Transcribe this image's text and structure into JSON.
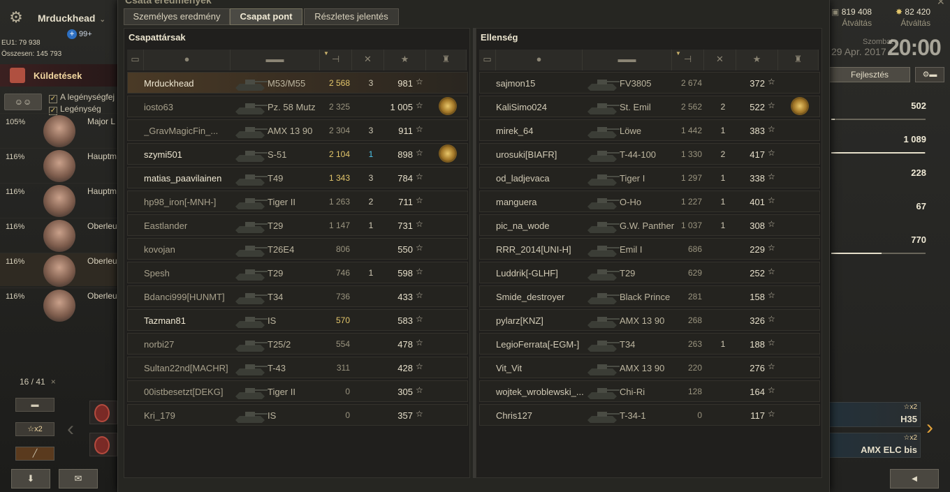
{
  "player": {
    "name": "Mrduckhead",
    "plus_badge": "99+",
    "eu_rating": "EU1: 79 938",
    "total": "Összesen: 145 793"
  },
  "left": {
    "missions_label": "Küldetések",
    "checks": [
      "A legénységfej",
      "Legénység auto"
    ],
    "crew": [
      {
        "pct": "105%",
        "rank": "Major L"
      },
      {
        "pct": "116%",
        "rank": "Hauptm"
      },
      {
        "pct": "116%",
        "rank": "Hauptm"
      },
      {
        "pct": "116%",
        "rank": "Oberleu"
      },
      {
        "pct": "116%",
        "rank": "Oberleu"
      },
      {
        "pct": "116%",
        "rank": "Oberleu"
      }
    ],
    "counter": "16 / 41",
    "counter_close": "×",
    "x2_label": "x2"
  },
  "right": {
    "credits": "819 408",
    "credits_label": "Átváltás",
    "gold": "82 420",
    "gold_label": "Átváltás",
    "weekday": "Szombat",
    "date": "29 Apr. 2017",
    "time": "20:00",
    "upgrade_label": "Fejlesztés",
    "stats": [
      "502",
      "1 089",
      "228",
      "67",
      "770"
    ],
    "stat_fills": [
      0.04,
      0.99,
      0,
      0,
      0.53
    ],
    "tanks": [
      {
        "name": "H35",
        "badge": "x2"
      },
      {
        "name": "AMX ELC bis",
        "badge": "x2"
      }
    ]
  },
  "dialog": {
    "title": "Csata eredmények",
    "tabs": [
      "Személyes eredmény",
      "Csapat pont",
      "Részletes jelentés"
    ],
    "active_tab": 1
  },
  "allies": {
    "title": "Csapattársak",
    "rows": [
      {
        "name": "Mrduckhead",
        "tank": "M53/M55",
        "dmg": "2 568",
        "kills": "3",
        "xp": "981",
        "medal": false,
        "self": true,
        "gold": true,
        "nameStyle": "bright"
      },
      {
        "name": "iosto63",
        "tank": "Pz. 58 Mutz",
        "dmg": "2 325",
        "kills": "",
        "xp": "1 005",
        "medal": true,
        "self": false,
        "gold": false,
        "nameStyle": "dim"
      },
      {
        "name": "_GravMagicFin_...",
        "tank": "AMX 13 90",
        "dmg": "2 304",
        "kills": "3",
        "xp": "911",
        "medal": false,
        "self": false,
        "gold": false,
        "nameStyle": "dim"
      },
      {
        "name": "szymi501",
        "tank": "S-51",
        "dmg": "2 104",
        "kills": "1",
        "xp": "898",
        "medal": true,
        "self": false,
        "gold": true,
        "nameStyle": "bright",
        "killsBlue": true
      },
      {
        "name": "matias_paavilainen",
        "tank": "T49",
        "dmg": "1 343",
        "kills": "3",
        "xp": "784",
        "medal": false,
        "self": false,
        "gold": true,
        "nameStyle": "bright"
      },
      {
        "name": "hp98_iron[-MNH-]",
        "tank": "Tiger II",
        "dmg": "1 263",
        "kills": "2",
        "xp": "711",
        "medal": false,
        "self": false,
        "gold": false,
        "nameStyle": "dim"
      },
      {
        "name": "Eastlander",
        "tank": "T29",
        "dmg": "1 147",
        "kills": "1",
        "xp": "731",
        "medal": false,
        "self": false,
        "gold": false,
        "nameStyle": "dim"
      },
      {
        "name": "kovojan",
        "tank": "T26E4",
        "dmg": "806",
        "kills": "",
        "xp": "550",
        "medal": false,
        "self": false,
        "gold": false,
        "nameStyle": "dim"
      },
      {
        "name": "Spesh",
        "tank": "T29",
        "dmg": "746",
        "kills": "1",
        "xp": "598",
        "medal": false,
        "self": false,
        "gold": false,
        "nameStyle": "dim"
      },
      {
        "name": "Bdanci999[HUNMT]",
        "tank": "T34",
        "dmg": "736",
        "kills": "",
        "xp": "433",
        "medal": false,
        "self": false,
        "gold": false,
        "nameStyle": "dim"
      },
      {
        "name": "Tazman81",
        "tank": "IS",
        "dmg": "570",
        "kills": "",
        "xp": "583",
        "medal": false,
        "self": false,
        "gold": true,
        "nameStyle": "bright"
      },
      {
        "name": "norbi27",
        "tank": "T25/2",
        "dmg": "554",
        "kills": "",
        "xp": "478",
        "medal": false,
        "self": false,
        "gold": false,
        "nameStyle": "dim"
      },
      {
        "name": "Sultan22nd[MACHR]",
        "tank": "T-43",
        "dmg": "311",
        "kills": "",
        "xp": "428",
        "medal": false,
        "self": false,
        "gold": false,
        "nameStyle": "dim"
      },
      {
        "name": "00istbesetzt[DEKG]",
        "tank": "Tiger II",
        "dmg": "0",
        "kills": "",
        "xp": "305",
        "medal": false,
        "self": false,
        "gold": false,
        "nameStyle": "dim"
      },
      {
        "name": "Kri_179",
        "tank": "IS",
        "dmg": "0",
        "kills": "",
        "xp": "357",
        "medal": false,
        "self": false,
        "gold": false,
        "nameStyle": "dim"
      }
    ]
  },
  "enemies": {
    "title": "Ellenség",
    "rows": [
      {
        "name": "sajmon15",
        "tank": "FV3805",
        "dmg": "2 674",
        "kills": "",
        "xp": "372",
        "medal": false
      },
      {
        "name": "KaliSimo024",
        "tank": "St. Emil",
        "dmg": "2 562",
        "kills": "2",
        "xp": "522",
        "medal": true
      },
      {
        "name": "mirek_64",
        "tank": "Löwe",
        "dmg": "1 442",
        "kills": "1",
        "xp": "383",
        "medal": false
      },
      {
        "name": "urosuki[BIAFR]",
        "tank": "T-44-100",
        "dmg": "1 330",
        "kills": "2",
        "xp": "417",
        "medal": false
      },
      {
        "name": "od_ladjevaca",
        "tank": "Tiger I",
        "dmg": "1 297",
        "kills": "1",
        "xp": "338",
        "medal": false
      },
      {
        "name": "manguera",
        "tank": "O-Ho",
        "dmg": "1 227",
        "kills": "1",
        "xp": "401",
        "medal": false
      },
      {
        "name": "pic_na_wode",
        "tank": "G.W. Panther",
        "dmg": "1 037",
        "kills": "1",
        "xp": "308",
        "medal": false
      },
      {
        "name": "RRR_2014[UNI-H]",
        "tank": "Emil I",
        "dmg": "686",
        "kills": "",
        "xp": "229",
        "medal": false
      },
      {
        "name": "Luddrik[-GLHF]",
        "tank": "T29",
        "dmg": "629",
        "kills": "",
        "xp": "252",
        "medal": false
      },
      {
        "name": "Smide_destroyer",
        "tank": "Black Prince",
        "dmg": "281",
        "kills": "",
        "xp": "158",
        "medal": false
      },
      {
        "name": "pylarz[KNZ]",
        "tank": "AMX 13 90",
        "dmg": "268",
        "kills": "",
        "xp": "326",
        "medal": false
      },
      {
        "name": "LegioFerrata[-EGM-]",
        "tank": "T34",
        "dmg": "263",
        "kills": "1",
        "xp": "188",
        "medal": false
      },
      {
        "name": "Vit_Vit",
        "tank": "AMX 13 90",
        "dmg": "220",
        "kills": "",
        "xp": "276",
        "medal": false
      },
      {
        "name": "wojtek_wroblewski_...",
        "tank": "Chi-Ri",
        "dmg": "128",
        "kills": "",
        "xp": "164",
        "medal": false
      },
      {
        "name": "Chris127",
        "tank": "T-34-1",
        "dmg": "0",
        "kills": "",
        "xp": "117",
        "medal": false
      }
    ]
  }
}
